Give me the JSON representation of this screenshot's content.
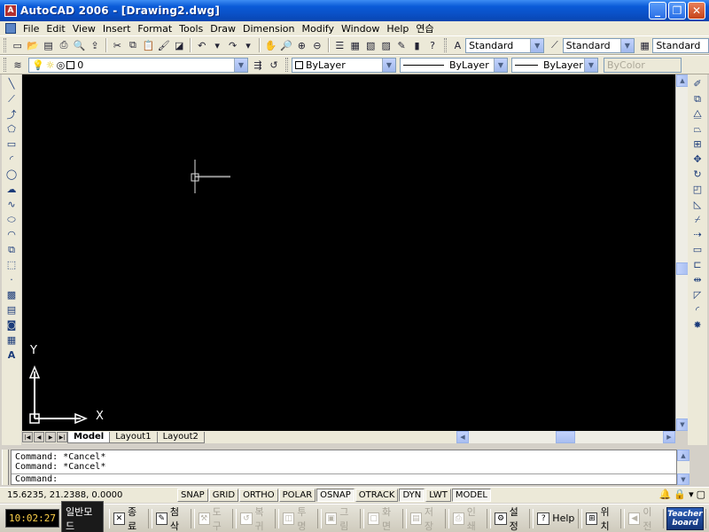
{
  "window": {
    "title": "AutoCAD 2006 - [Drawing2.dwg]",
    "buttons": [
      "_",
      "❐",
      "✕"
    ]
  },
  "menubar": {
    "items": [
      "File",
      "Edit",
      "View",
      "Insert",
      "Format",
      "Tools",
      "Draw",
      "Dimension",
      "Modify",
      "Window",
      "Help",
      "연습"
    ]
  },
  "toolbar_standard": {
    "text_style": "Standard",
    "dim_style": "Standard",
    "table_style": "Standard"
  },
  "toolbar_layers": {
    "layer": "0",
    "color": "ByLayer",
    "linetype": "ByLayer",
    "lineweight": "ByLayer",
    "plotstyle": "ByColor"
  },
  "canvas": {
    "background": "#000000",
    "ucs_y_label": "Y",
    "ucs_x_label": "X"
  },
  "tabs": [
    "Model",
    "Layout1",
    "Layout2"
  ],
  "command_window": {
    "history": [
      "Command: *Cancel*",
      "Command: *Cancel*"
    ],
    "prompt": "Command:"
  },
  "statusbar": {
    "coords": "15.6235, 21.2388, 0.0000",
    "toggles": [
      "SNAP",
      "GRID",
      "ORTHO",
      "POLAR",
      "OSNAP",
      "OTRACK",
      "DYN",
      "LWT",
      "MODEL"
    ]
  },
  "taskbar": {
    "clock": "10:02:27",
    "mode": "일반모드",
    "items": [
      {
        "label": "종료",
        "icon": "✕",
        "dim": false
      },
      {
        "label": "첨삭",
        "icon": "✎",
        "dim": false
      },
      {
        "label": "도구",
        "icon": "⚒",
        "dim": true
      },
      {
        "label": "복귀",
        "icon": "↺",
        "dim": true
      },
      {
        "label": "투명",
        "icon": "◫",
        "dim": true
      },
      {
        "label": "그림",
        "icon": "▣",
        "dim": true
      },
      {
        "label": "화면",
        "icon": "▢",
        "dim": true
      },
      {
        "label": "저장",
        "icon": "▤",
        "dim": true
      },
      {
        "label": "인쇄",
        "icon": "⎙",
        "dim": true
      },
      {
        "label": "설정",
        "icon": "⚙",
        "dim": false
      },
      {
        "label": "Help",
        "icon": "?",
        "dim": false
      },
      {
        "label": "위치",
        "icon": "⊞",
        "dim": false
      },
      {
        "label": "이전",
        "icon": "◀",
        "dim": true
      },
      {
        "label": "다음",
        "icon": "▶",
        "dim": true
      }
    ],
    "logo": "Teacher board"
  }
}
